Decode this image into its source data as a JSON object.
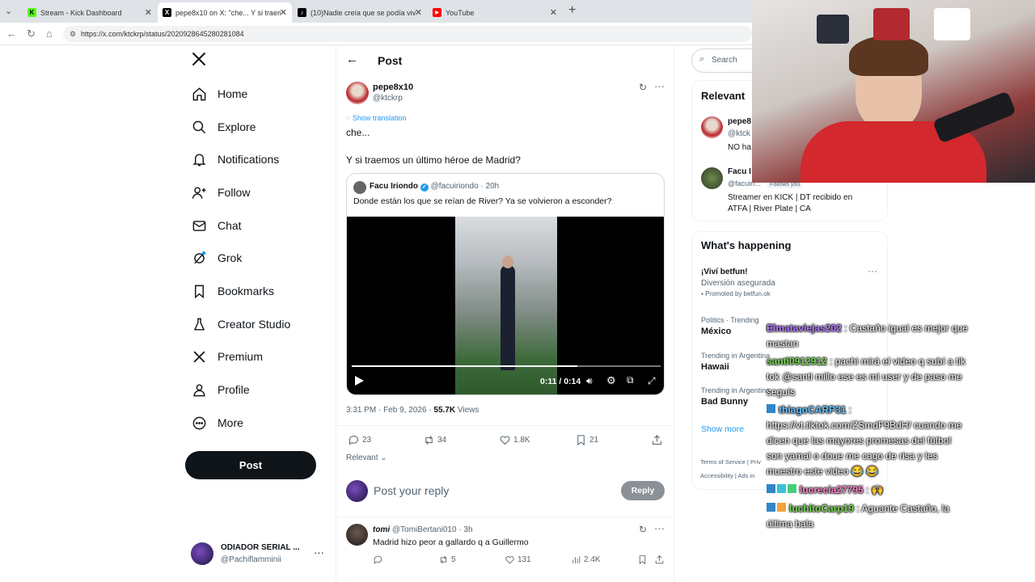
{
  "browser": {
    "tabs": [
      {
        "title": "Stream - Kick Dashboard",
        "favicon": "K",
        "color": "#53fc18",
        "active": false
      },
      {
        "title": "pepe8x10 on X: \"che... Y si traemos",
        "favicon": "X",
        "color": "#000000",
        "active": true
      },
      {
        "title": "(10)Nadie creía que se podía vivir",
        "favicon": "♪",
        "color": "#000000",
        "active": false
      },
      {
        "title": "YouTube",
        "favicon": "▶",
        "color": "#ff0000",
        "active": false
      }
    ],
    "url": "https://x.com/ktckrp/status/2020928645280281084"
  },
  "sidebar": {
    "items": [
      {
        "label": "Home",
        "icon": "home-icon"
      },
      {
        "label": "Explore",
        "icon": "search-icon"
      },
      {
        "label": "Notifications",
        "icon": "bell-icon"
      },
      {
        "label": "Follow",
        "icon": "person-plus-icon"
      },
      {
        "label": "Chat",
        "icon": "mail-icon"
      },
      {
        "label": "Grok",
        "icon": "grok-icon"
      },
      {
        "label": "Bookmarks",
        "icon": "bookmark-icon"
      },
      {
        "label": "Creator Studio",
        "icon": "flask-icon"
      },
      {
        "label": "Premium",
        "icon": "x-logo-icon"
      },
      {
        "label": "Profile",
        "icon": "person-icon"
      },
      {
        "label": "More",
        "icon": "more-circle-icon"
      }
    ],
    "post_label": "Post",
    "account": {
      "name": "ODIADOR SERIAL ...",
      "handle": "@Pachiflamminii"
    }
  },
  "header": {
    "title": "Post"
  },
  "post": {
    "author": "pepe8x10",
    "handle": "@ktckrp",
    "translate": "Show translation",
    "line1": "che...",
    "line2": "Y si traemos un último héroe de Madrid?",
    "quote": {
      "author": "Facu Iriondo",
      "handle": "@facuiriondo",
      "time": "· 20h",
      "text": "Donde están los que se reían de River? Ya se volvieron a esconder?"
    },
    "video": {
      "time": "0:11 / 0:14",
      "progress": 0.73
    },
    "timestamp": "3:31 PM · Feb 9, 2026 ·",
    "views_count": "55.7K",
    "views_label": "Views",
    "replies": "23",
    "reposts": "34",
    "likes": "1.8K",
    "bookmarks": "21",
    "sort_label": "Relevant"
  },
  "reply_box": {
    "placeholder": "Post your reply",
    "button": "Reply"
  },
  "reply": {
    "author": "tomi",
    "handle": "@TomiBertani010",
    "time": "· 3h",
    "text": "Madrid hizo peor a gallardo q a Guillermo",
    "replies": "",
    "reposts": "5",
    "likes": "131",
    "views": "2.4K"
  },
  "right": {
    "search_placeholder": "Search",
    "relevant_title": "Relevant",
    "relevant": [
      {
        "name": "pepe8",
        "handle": "@ktck",
        "bio": "NO ha"
      },
      {
        "name": "Facu I",
        "handle": "@facuiri...",
        "follows": "Follows you",
        "bio": "Streamer en KICK | DT recibido en ATFA | River Plate | CA"
      }
    ],
    "happening_title": "What's happening",
    "trends": [
      {
        "category": "",
        "name": "¡Viví betfun!",
        "sub": "Diversión asegurada",
        "promo": "Promoted by betfun.ok"
      },
      {
        "category": "Politics · Trending",
        "name": "México"
      },
      {
        "category": "Trending in Argentina",
        "name": "Hawaii"
      },
      {
        "category": "Trending in Argentina",
        "name": "Bad Bunny"
      }
    ],
    "show_more": "Show more",
    "footer1": "Terms of Service  |  Priv",
    "footer2": "Accessibility  |  Ads in"
  },
  "chat": [
    {
      "user": "Elmataviejas202",
      "user_color": "#b57bff",
      "text": " : Castaño igual es mejor que mastan"
    },
    {
      "user": "santi0912912",
      "user_color": "#7bd957",
      "text": " : pachi mirá el video q subí a tik tok @santi millo ese es mi user y de paso me seguís"
    },
    {
      "user": "thiagoCARP31",
      "user_color": "#66c2ff",
      "text": " : https://vt.tiktok.com/ZSmdF9BdH/ cuando me dicen que las mayores promesas del fútbol son yamal o doue me cago de risa y les muestro este video 😂 😂"
    },
    {
      "user": "lucrecia27795",
      "user_color": "#ff85c8",
      "text": " : 🙌"
    },
    {
      "user": "luchitoCarp19",
      "user_color": "#7bd957",
      "text": " : Aguante Castaño, la última bala"
    }
  ],
  "colors": {
    "accent": "#1d9bf0",
    "kick_green": "#53fc18",
    "river_red": "#d3282d"
  }
}
